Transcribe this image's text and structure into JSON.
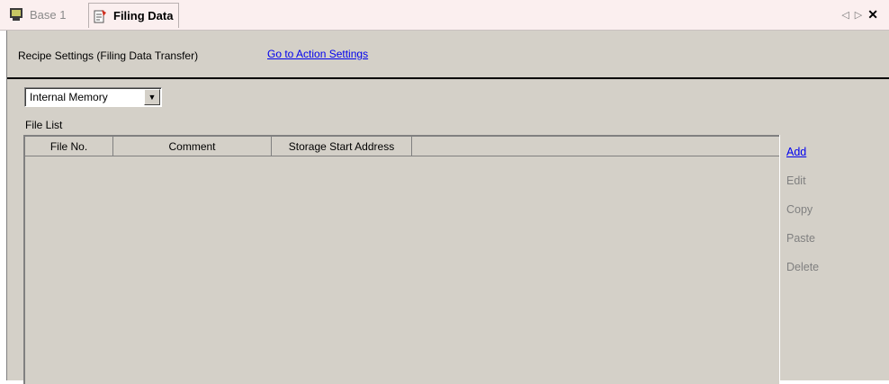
{
  "tabs": [
    {
      "label": "Base 1",
      "icon": "monitor-icon",
      "active": false
    },
    {
      "label": "Filing Data",
      "icon": "filing-data-icon",
      "active": true
    }
  ],
  "header": {
    "title": "Recipe Settings (Filing Data Transfer)",
    "action_link": "Go to Action Settings"
  },
  "storage_select": {
    "value": "Internal Memory"
  },
  "file_list": {
    "label": "File List",
    "columns": [
      "File No.",
      "Comment",
      "Storage Start Address",
      ""
    ],
    "rows": []
  },
  "side_buttons": {
    "add": "Add",
    "edit": "Edit",
    "copy": "Copy",
    "paste": "Paste",
    "delete": "Delete"
  },
  "colors": {
    "panel_bg": "#d4d0c8",
    "tab_bg": "#fbefef",
    "link": "#0000ee",
    "disabled": "#808080"
  }
}
